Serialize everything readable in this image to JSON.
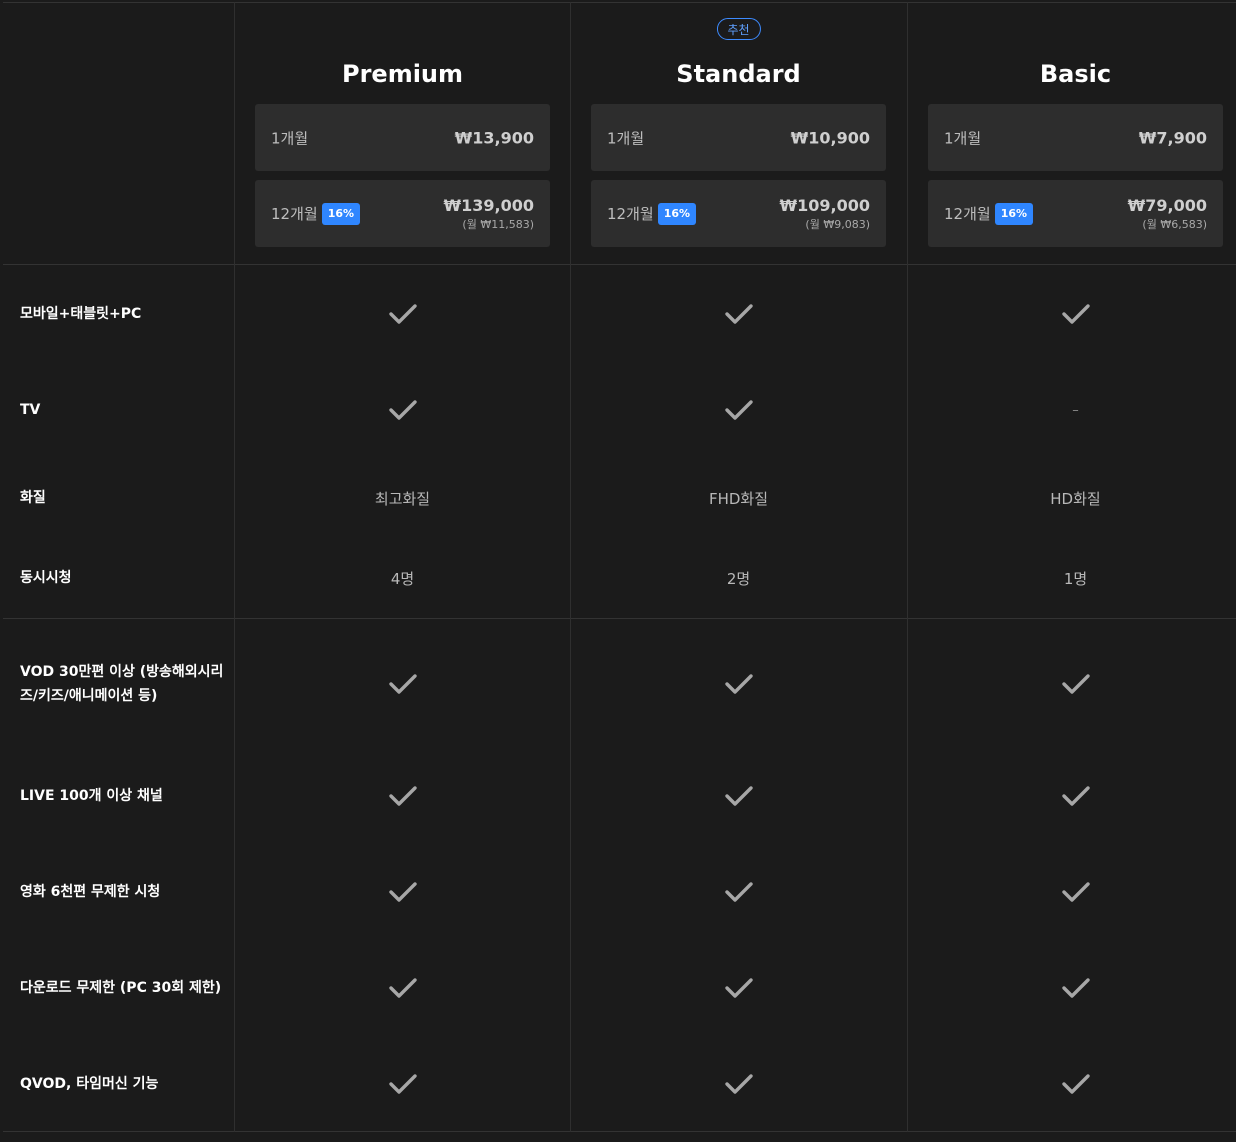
{
  "plans": [
    {
      "name": "Premium",
      "badge": "",
      "monthly": {
        "period": "1개월",
        "price": "₩13,900"
      },
      "yearly": {
        "period": "12개월",
        "discount": "16%",
        "price": "₩139,000",
        "per_month": "(월 ₩11,583)"
      }
    },
    {
      "name": "Standard",
      "badge": "추천",
      "monthly": {
        "period": "1개월",
        "price": "₩10,900"
      },
      "yearly": {
        "period": "12개월",
        "discount": "16%",
        "price": "₩109,000",
        "per_month": "(월 ₩9,083)"
      }
    },
    {
      "name": "Basic",
      "badge": "",
      "monthly": {
        "period": "1개월",
        "price": "₩7,900"
      },
      "yearly": {
        "period": "12개월",
        "discount": "16%",
        "price": "₩79,000",
        "per_month": "(월 ₩6,583)"
      }
    }
  ],
  "features": [
    {
      "label": "모바일+태블릿+PC",
      "values": [
        "check",
        "check",
        "check"
      ]
    },
    {
      "label": "TV",
      "values": [
        "check",
        "check",
        "dash"
      ]
    },
    {
      "label": "화질",
      "values": [
        "최고화질",
        "FHD화질",
        "HD화질"
      ]
    },
    {
      "label": "동시시청",
      "values": [
        "4명",
        "2명",
        "1명"
      ]
    },
    {
      "label": "VOD 30만편 이상 (방송해외시리즈/키즈/애니메이션 등)",
      "values": [
        "check",
        "check",
        "check"
      ]
    },
    {
      "label": "LIVE 100개 이상 채널",
      "values": [
        "check",
        "check",
        "check"
      ]
    },
    {
      "label": "영화 6천편 무제한 시청",
      "values": [
        "check",
        "check",
        "check"
      ]
    },
    {
      "label": "다운로드 무제한 (PC 30회 제한)",
      "values": [
        "check",
        "check",
        "check"
      ]
    },
    {
      "label": "QVOD, 타임머신 기능",
      "values": [
        "check",
        "check",
        "check"
      ]
    }
  ],
  "symbols": {
    "dash": "–"
  },
  "icons": {
    "check": "check-icon"
  },
  "colors": {
    "background": "#1b1b1b",
    "accent": "#2f86ff",
    "badge_outline": "#3d8bff"
  }
}
